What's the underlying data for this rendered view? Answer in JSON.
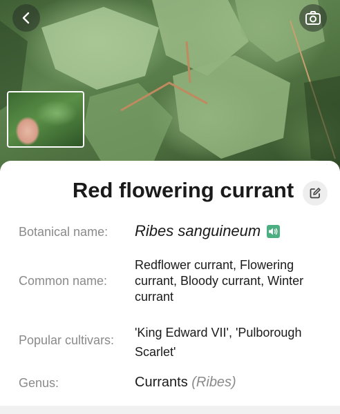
{
  "plant": {
    "title": "Red flowering currant",
    "fields": {
      "botanical_label": "Botanical name:",
      "botanical_value": "Ribes sanguineum",
      "common_label": "Common name:",
      "common_value": "Redflower currant, Flowering currant, Bloody currant, Winter currant",
      "cultivars_label": "Popular cultivars:",
      "cultivars_value": "'King Edward VII', 'Pulborough Scarlet'",
      "genus_label": "Genus:",
      "genus_value": "Currants",
      "genus_latin": "(Ribes)"
    }
  },
  "icons": {
    "back": "chevron-left-icon",
    "camera": "camera-icon",
    "edit": "edit-icon",
    "pronounce": "speaker-icon"
  },
  "colors": {
    "accent_green": "#4caf82",
    "label_gray": "#8a8a8a",
    "title_text": "#1a1a1a"
  }
}
